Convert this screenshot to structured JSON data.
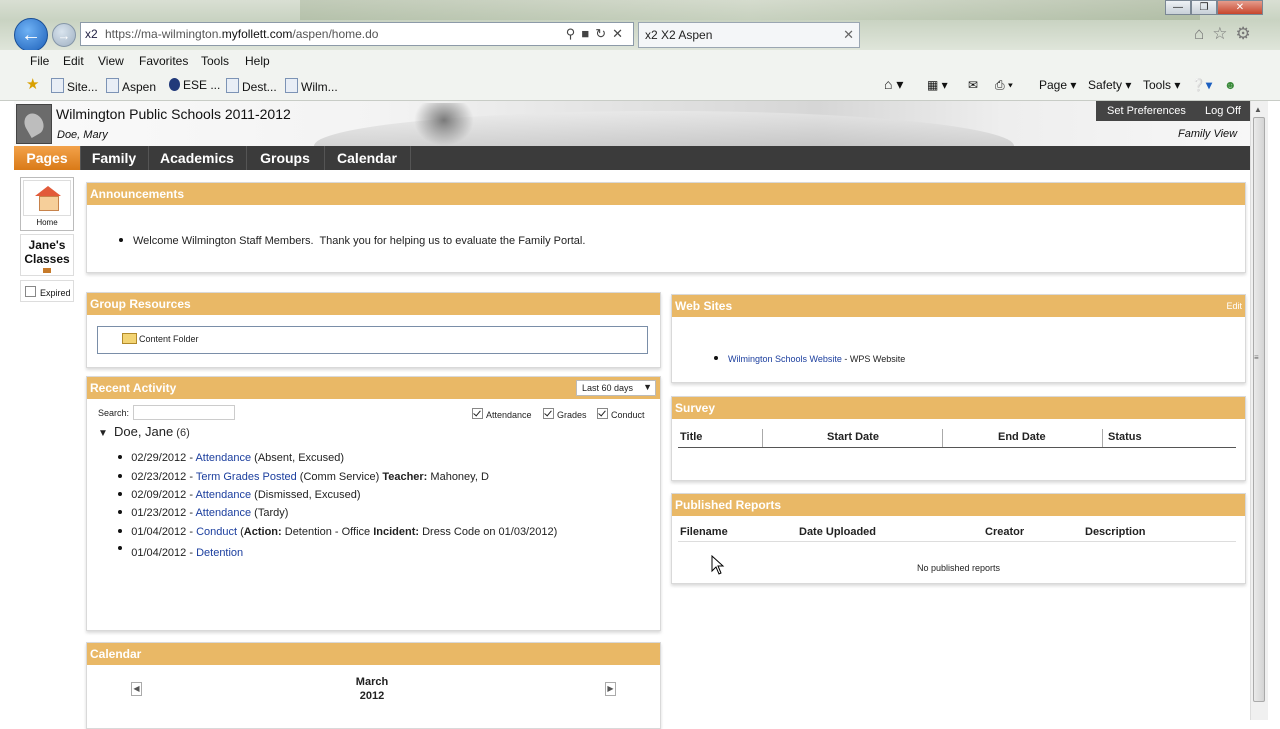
{
  "browser": {
    "address_prefix": "x2",
    "url_scheme": "https://",
    "url_domain_pre": "ma-wilmington.",
    "url_domain": "myfollett.com",
    "url_path": "/aspen/home.do",
    "tab_icon": "x2",
    "tab_title": "X2 Aspen",
    "menu": [
      "File",
      "Edit",
      "View",
      "Favorites",
      "Tools",
      "Help"
    ],
    "favorites": [
      "Site...",
      "Aspen",
      "ESE ...",
      "Dest...",
      "Wilm..."
    ],
    "commands": [
      "Page",
      "Safety",
      "Tools"
    ]
  },
  "header": {
    "school": "Wilmington Public Schools 2011-2012",
    "user": "Doe, Mary",
    "set_preferences": "Set Preferences",
    "log_off": "Log Off",
    "view_mode": "Family View"
  },
  "nav": {
    "tabs": [
      "Pages",
      "Family",
      "Academics",
      "Groups",
      "Calendar"
    ],
    "active": "Pages"
  },
  "sidebar": {
    "home_label": "Home",
    "classes_label": "Jane's Classes",
    "expired_label": "Expired"
  },
  "announcements": {
    "title": "Announcements",
    "items": [
      "Welcome Wilmington Staff Members.  Thank you for helping us to evaluate the Family Portal."
    ]
  },
  "group_resources": {
    "title": "Group Resources",
    "folder": "Content Folder"
  },
  "recent_activity": {
    "title": "Recent Activity",
    "range": "Last 60 days",
    "search_label": "Search:",
    "filters": [
      "Attendance",
      "Grades",
      "Conduct"
    ],
    "student": "Doe, Jane",
    "count": "(6)",
    "items": [
      {
        "date": "02/29/2012 - ",
        "link": "Attendance",
        "rest": " (Absent, Excused)"
      },
      {
        "date": "02/23/2012 - ",
        "link": "Term Grades Posted",
        "rest": " (Comm Service) ",
        "bold": "Teacher:",
        "rest2": " Mahoney, D"
      },
      {
        "date": "02/09/2012 - ",
        "link": "Attendance",
        "rest": " (Dismissed, Excused)"
      },
      {
        "date": "01/23/2012 - ",
        "link": "Attendance",
        "rest": " (Tardy)"
      },
      {
        "date": "01/04/2012 - ",
        "link": "Conduct",
        "rest": " (",
        "bold": "Action:",
        "rest2": " Detention - Office ",
        "bold2": "Incident:",
        "rest3": " Dress Code on 01/03/2012)"
      },
      {
        "date": "01/04/2012 - ",
        "link": "Detention",
        "rest": ""
      }
    ]
  },
  "calendar": {
    "title": "Calendar",
    "month": "March",
    "year": "2012"
  },
  "web_sites": {
    "title": "Web Sites",
    "edit": "Edit",
    "items": [
      {
        "link": "Wilmington Schools Website",
        "desc": " - WPS Website"
      }
    ]
  },
  "survey": {
    "title": "Survey",
    "columns": [
      "Title",
      "Start Date",
      "End Date",
      "Status"
    ]
  },
  "published_reports": {
    "title": "Published Reports",
    "columns": [
      "Filename",
      "Date Uploaded",
      "Creator",
      "Description"
    ],
    "empty": "No published reports"
  }
}
